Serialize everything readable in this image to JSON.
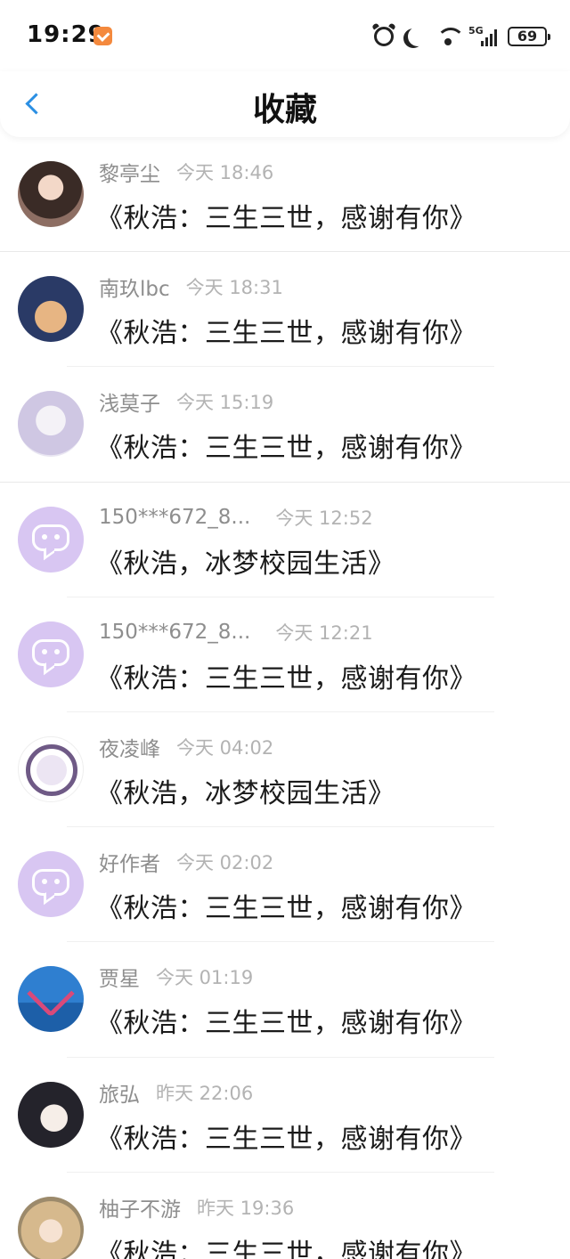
{
  "status_bar": {
    "time": "19:29",
    "network": "5G",
    "battery": "69"
  },
  "header": {
    "title": "收藏"
  },
  "items": [
    {
      "name": "黎亭尘",
      "time": "今天 18:46",
      "title": "《秋浩：三生三世，感谢有你》"
    },
    {
      "name": "南玖lbc",
      "time": "今天 18:31",
      "title": "《秋浩：三生三世，感谢有你》"
    },
    {
      "name": "浅莫子",
      "time": "今天 15:19",
      "title": "《秋浩：三生三世，感谢有你》"
    },
    {
      "name": "150***672_8...",
      "time": "今天 12:52",
      "title": "《秋浩，冰梦校园生活》"
    },
    {
      "name": "150***672_8...",
      "time": "今天 12:21",
      "title": "《秋浩：三生三世，感谢有你》"
    },
    {
      "name": "夜凌峰",
      "time": "今天 04:02",
      "title": "《秋浩，冰梦校园生活》"
    },
    {
      "name": "好作者",
      "time": "今天 02:02",
      "title": "《秋浩：三生三世，感谢有你》"
    },
    {
      "name": "贾星",
      "time": "今天 01:19",
      "title": "《秋浩：三生三世，感谢有你》"
    },
    {
      "name": "旅弘",
      "time": "昨天 22:06",
      "title": "《秋浩：三生三世，感谢有你》"
    },
    {
      "name": "柚子不游",
      "time": "昨天 19:36",
      "title": "《秋浩：三生三世，感谢有你》"
    }
  ]
}
